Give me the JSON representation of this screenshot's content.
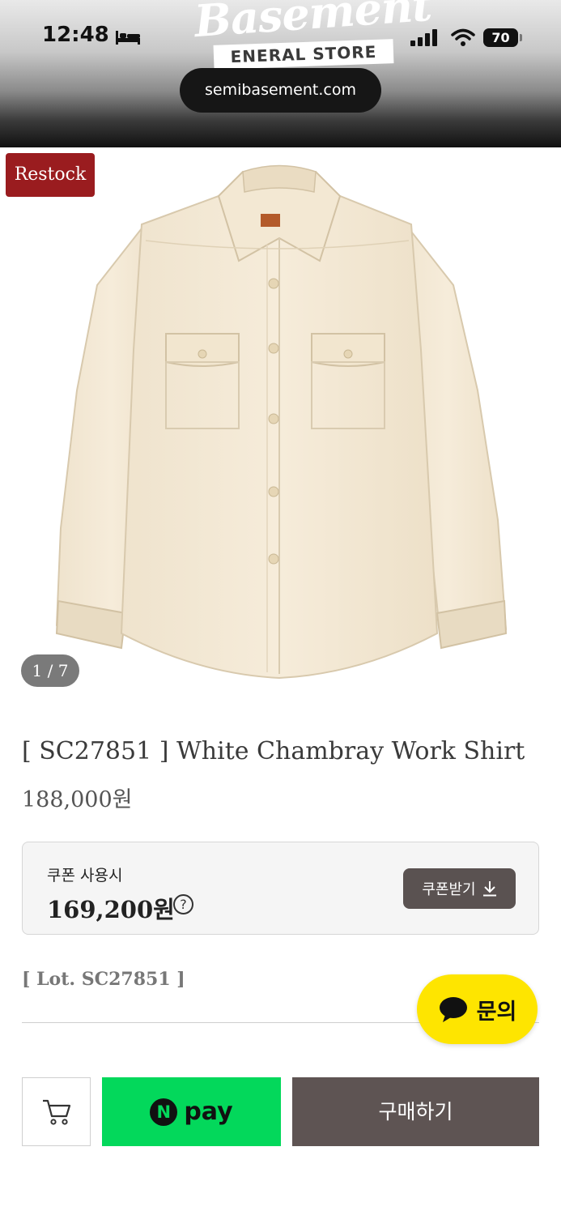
{
  "status_bar": {
    "time": "12:48",
    "battery": "70"
  },
  "header": {
    "logo_script": "Basement",
    "logo_band": "ENERAL STORE",
    "url": "semibasement.com"
  },
  "product": {
    "badge": "Restock",
    "image_counter": "1 / 7",
    "title": "[ SC27851 ] White Chambray Work Shirt",
    "price": "188,000원"
  },
  "coupon": {
    "label": "쿠폰 사용시",
    "price": "169,200원",
    "info_symbol": "?",
    "button_label": "쿠폰받기"
  },
  "lot": "[ Lot. SC27851 ]",
  "chat": {
    "label": "문의"
  },
  "bottom_bar": {
    "npay_logo": "N",
    "npay_text": "pay",
    "buy_label": "구매하기"
  },
  "colors": {
    "restock_badge": "#9a1c1f",
    "coupon_button": "#5a5251",
    "npay_green": "#03d85b",
    "buy_button": "#5e5453",
    "chat_yellow": "#fee500"
  },
  "icons": [
    "bed-icon",
    "signal-icon",
    "wifi-icon",
    "info-icon",
    "download-icon",
    "chat-bubble-icon",
    "cart-icon"
  ]
}
